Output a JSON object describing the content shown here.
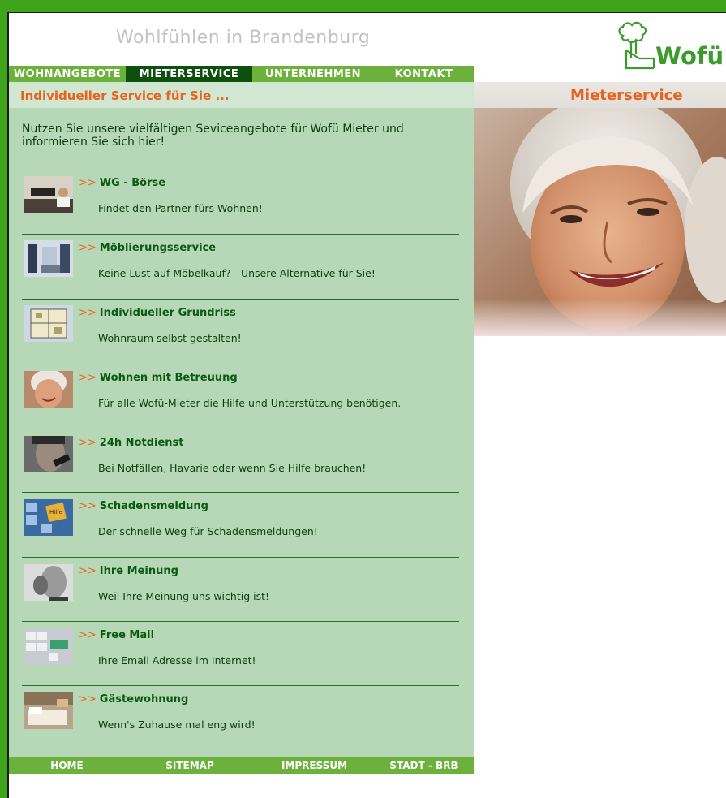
{
  "header": {
    "tagline": "Wohlfühlen in Brandenburg",
    "logo_text": "Wofü"
  },
  "nav": [
    {
      "label": "WOHNANGEBOTE",
      "active": false
    },
    {
      "label": "MIETERSERVICE",
      "active": true
    },
    {
      "label": "UNTERNEHMEN",
      "active": false
    },
    {
      "label": "KONTAKT",
      "active": false
    }
  ],
  "section_title": "Individueller Service für Sie ...",
  "hero_title": "Mieterservice",
  "intro": "Nutzen Sie unsere vielfältigen Seviceangebote für Wofü Mieter und informieren Sie sich hier!",
  "arrow": ">>",
  "services": [
    {
      "title": "WG - Börse",
      "desc": "Findet den Partner fürs Wohnen!",
      "thumb": "shared-flat-thumbnail"
    },
    {
      "title": "Möblierungsservice",
      "desc": "Keine Lust auf Möbelkauf? - Unsere Alternative für Sie!",
      "thumb": "furnished-room-thumbnail"
    },
    {
      "title": "Individueller Grundriss",
      "desc": "Wohnraum selbst gestalten!",
      "thumb": "floor-plan-thumbnail"
    },
    {
      "title": "Wohnen mit Betreuung",
      "desc": "Für alle Wofü-Mieter die Hilfe und Unterstützung benötigen.",
      "thumb": "elderly-woman-thumbnail"
    },
    {
      "title": "24h Notdienst",
      "desc": "Bei Notfällen, Havarie oder wenn Sie Hilfe brauchen!",
      "thumb": "man-on-phone-thumbnail"
    },
    {
      "title": "Schadensmeldung",
      "desc": "Der schnelle Weg für Schadensmeldungen!",
      "thumb": "help-key-thumbnail"
    },
    {
      "title": "Ihre Meinung",
      "desc": "Weil Ihre Meinung uns wichtig ist!",
      "thumb": "man-listening-thumbnail"
    },
    {
      "title": "Free Mail",
      "desc": "Ihre Email Adresse im Internet!",
      "thumb": "keyboard-thumbnail"
    },
    {
      "title": "Gästewohnung",
      "desc": "Wenn's Zuhause mal eng wird!",
      "thumb": "guest-bedroom-thumbnail"
    }
  ],
  "footer": [
    "HOME",
    "SITEMAP",
    "IMPRESSUM",
    "STADT - BRB"
  ],
  "colors": {
    "brand_green": "#3ea51b",
    "nav_green": "#6cb13c",
    "active_nav": "#0f4f0d",
    "accent_orange": "#e8641e",
    "content_bg": "#b7d8b7"
  }
}
